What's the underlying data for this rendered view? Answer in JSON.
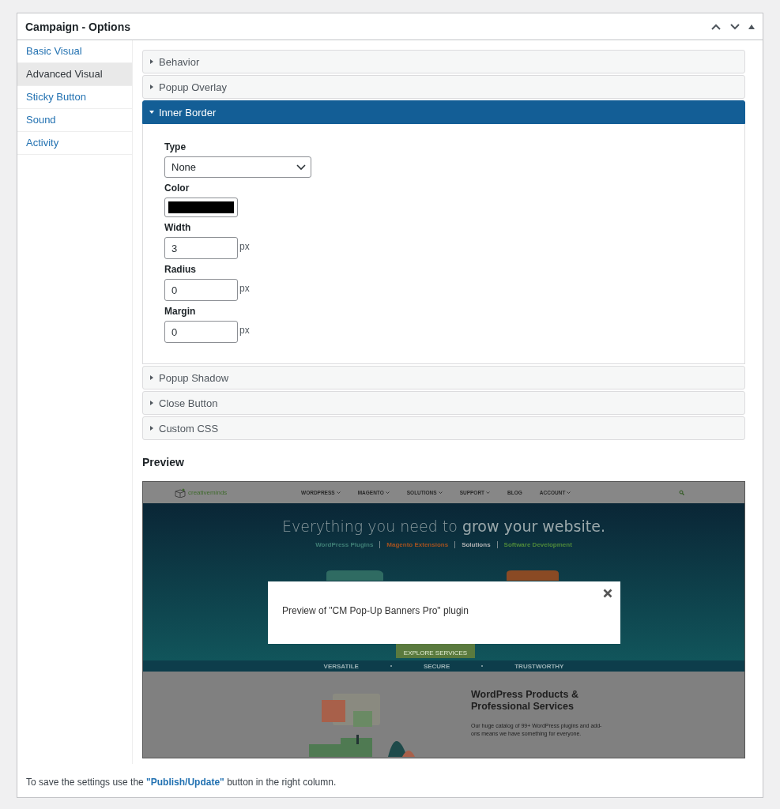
{
  "panel": {
    "title": "Campaign - Options"
  },
  "sidebar": {
    "items": [
      {
        "label": "Basic Visual",
        "selected": false
      },
      {
        "label": "Advanced Visual",
        "selected": true
      },
      {
        "label": "Sticky Button",
        "selected": false
      },
      {
        "label": "Sound",
        "selected": false
      },
      {
        "label": "Activity",
        "selected": false
      }
    ]
  },
  "sections": [
    {
      "title": "Behavior",
      "expanded": false
    },
    {
      "title": "Popup Overlay",
      "expanded": false
    },
    {
      "title": "Inner Border",
      "expanded": true,
      "fields": [
        {
          "label": "Type",
          "kind": "select",
          "value": "None"
        },
        {
          "label": "Color",
          "kind": "color",
          "color": "#000000"
        },
        {
          "label": "Width",
          "kind": "number",
          "value": "3",
          "unit": "px"
        },
        {
          "label": "Radius",
          "kind": "number",
          "value": "0",
          "unit": "px"
        },
        {
          "label": "Margin",
          "kind": "number",
          "value": "0",
          "unit": "px"
        }
      ]
    },
    {
      "title": "Popup Shadow",
      "expanded": false
    },
    {
      "title": "Close Button",
      "expanded": false
    },
    {
      "title": "Custom CSS",
      "expanded": false
    }
  ],
  "preview": {
    "heading": "Preview",
    "website": {
      "logo": "creativeminds",
      "nav": [
        {
          "label": "WORDPRESS",
          "has_menu": true
        },
        {
          "label": "MAGENTO",
          "has_menu": true
        },
        {
          "label": "SOLUTIONS",
          "has_menu": true
        },
        {
          "label": "SUPPORT",
          "has_menu": true
        },
        {
          "label": "BLOG",
          "has_menu": false
        },
        {
          "label": "ACCOUNT",
          "has_menu": true
        }
      ],
      "headline": "Everything you need to **grow your website.**",
      "links": [
        {
          "label": "WordPress Plugins",
          "color": "#3f7f76"
        },
        {
          "label": "Magento Extensions",
          "color": "#a4521f"
        },
        {
          "label": "Solutions",
          "color": "#b5b5b5"
        },
        {
          "label": "Software Development",
          "color": "#4f8a3a"
        }
      ],
      "cta": "EXPLORE SERVICES",
      "values": [
        "VERSATILE",
        "SECURE",
        "TRUSTWORTHY"
      ],
      "products_heading": "WordPress Products & Professional Services",
      "products_text": "Our huge catalog of 99+ WordPress plugins and add-ons means we have something for everyone."
    },
    "popup": {
      "text": "Preview of \"CM Pop-Up Banners Pro\" plugin"
    }
  },
  "footer": {
    "before": "To save the settings use the ",
    "link": "\"Publish/Update\"",
    "after": " button in the right column."
  }
}
